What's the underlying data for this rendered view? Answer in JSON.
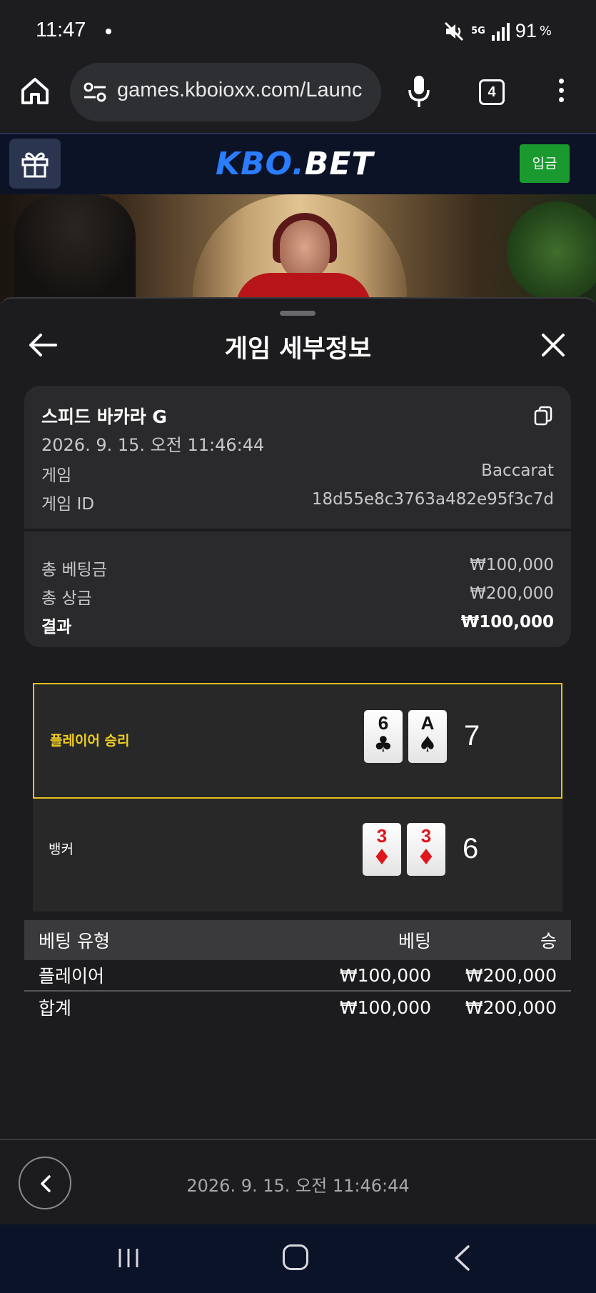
{
  "status_bar": {
    "time": "11:47",
    "network": "5G",
    "battery": "91",
    "battery_unit": "%"
  },
  "browser": {
    "url": "games.kboioxx.com/Launc",
    "tab_count": "4"
  },
  "site": {
    "logo_part1": "KBO.",
    "logo_part2": "BET",
    "deposit_label": "입금"
  },
  "sheet": {
    "title": "게임 세부정보",
    "game_name": "스피드 바카라 G",
    "datetime": "2026. 9. 15. 오전 11:46:44",
    "game_label": "게임",
    "game_value": "Baccarat",
    "game_id_label": "게임 ID",
    "game_id_value": "18d55e8c3763a482e95f3c7d",
    "total_bet_label": "총 베팅금",
    "total_bet_value": "₩100,000",
    "total_prize_label": "총 상금",
    "total_prize_value": "₩200,000",
    "result_label": "결과",
    "result_value": "₩100,000"
  },
  "outcomes": {
    "player": {
      "label": "플레이어 승리",
      "cards": [
        {
          "rank": "6",
          "suit": "♣",
          "color": "black"
        },
        {
          "rank": "A",
          "suit": "♠",
          "color": "black"
        }
      ],
      "score": "7"
    },
    "banker": {
      "label": "뱅커",
      "cards": [
        {
          "rank": "3",
          "suit": "♦",
          "color": "red"
        },
        {
          "rank": "3",
          "suit": "♦",
          "color": "red"
        }
      ],
      "score": "6"
    }
  },
  "bet_table": {
    "headers": [
      "베팅 유형",
      "베팅",
      "승"
    ],
    "rows": [
      [
        "플레이어",
        "₩100,000",
        "₩200,000"
      ]
    ],
    "total": [
      "합계",
      "₩100,000",
      "₩200,000"
    ]
  },
  "footer": {
    "datetime": "2026. 9. 15. 오전 11:46:44"
  },
  "colors": {
    "accent_yellow": "#e4c11d",
    "deposit_green": "#1a9a2e",
    "logo_blue": "#2b7dff",
    "card_red": "#e0161d"
  }
}
